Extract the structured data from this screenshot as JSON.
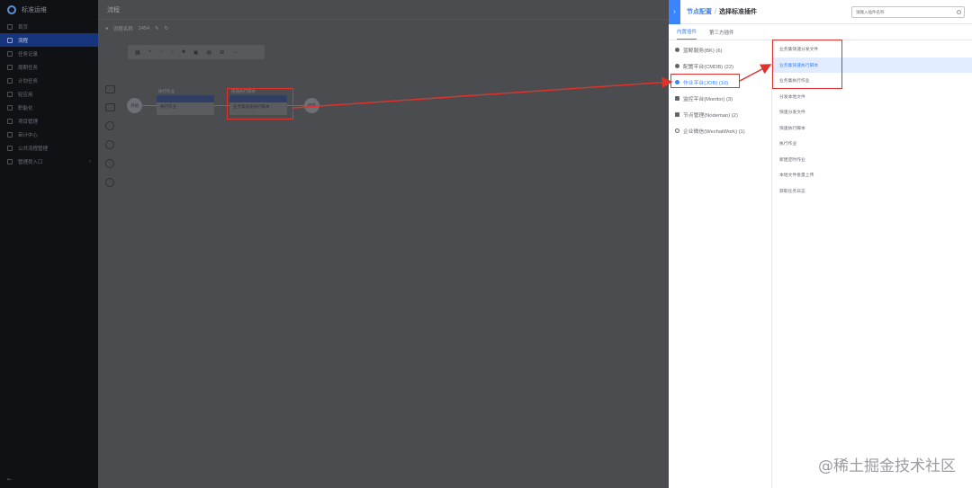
{
  "sidebar": {
    "brand": "标准运维",
    "items": [
      {
        "label": "首页"
      },
      {
        "label": "流程"
      },
      {
        "label": "任务记录"
      },
      {
        "label": "周期任务"
      },
      {
        "label": "计划任务"
      },
      {
        "label": "轻应用"
      },
      {
        "label": "职能化"
      },
      {
        "label": "项目管理"
      },
      {
        "label": "审计中心"
      },
      {
        "label": "公共流程管理"
      },
      {
        "label": "管理员入口"
      }
    ],
    "active_index": 1
  },
  "main": {
    "topbar_title": "流程",
    "sub_title": "流程名称",
    "version": "2454",
    "nodes": {
      "start": "开始",
      "end": "结束",
      "task1_title": "执行作业",
      "task1_label": "执行作业",
      "task2_title": "快速执行脚本",
      "task2_label": "业务集快速执行脚本"
    }
  },
  "panel": {
    "breadcrumb_parent": "节点配置",
    "breadcrumb_sep": "/",
    "breadcrumb_current": "选择标准插件",
    "search_placeholder": "请输入插件名称",
    "tabs": [
      {
        "label": "内置插件"
      },
      {
        "label": "第三方插件"
      }
    ],
    "active_tab": 0,
    "groups": [
      {
        "label": "蓝鲸服务(BK) (6)"
      },
      {
        "label": "配置平台(CMDB) (22)"
      },
      {
        "label": "作业平台(JOB) (10)"
      },
      {
        "label": "监控平台(Monitor) (3)"
      },
      {
        "label": "节点管理(Nodeman) (2)"
      },
      {
        "label": "企业微信(WechatWork) (1)"
      }
    ],
    "active_group": 2,
    "plugins": [
      {
        "label": "业务集快速分发文件"
      },
      {
        "label": "业务集快速执行脚本"
      },
      {
        "label": "业务集执行作业"
      },
      {
        "label": "分发本地文件"
      },
      {
        "label": "快速分发文件"
      },
      {
        "label": "快速执行脚本"
      },
      {
        "label": "执行作业"
      },
      {
        "label": "新建定时作业"
      },
      {
        "label": "本地文件批量上传"
      },
      {
        "label": "获取任务日志"
      }
    ],
    "active_plugin": 1
  },
  "watermark": "@稀土掘金技术社区",
  "colors": {
    "accent": "#3a84ff",
    "highlight_red": "#e0322c",
    "sidebar_bg": "#101115",
    "sidebar_active": "#16357d"
  }
}
